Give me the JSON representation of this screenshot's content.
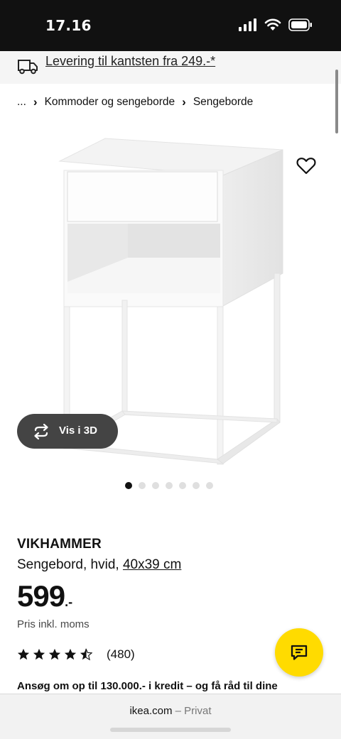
{
  "status_bar": {
    "time": "17.16"
  },
  "promo": {
    "text": "Levering til kantsten fra 249.-*"
  },
  "breadcrumb": {
    "ellipsis": "...",
    "items": [
      "Kommoder og sengeborde",
      "Sengeborde"
    ]
  },
  "gallery": {
    "view_3d_label": "Vis i 3D",
    "dots_total": 7,
    "active_dot": 1
  },
  "product": {
    "name": "VIKHAMMER",
    "description": "Sengebord, hvid,",
    "size": "40x39 cm",
    "price": "599",
    "price_suffix": ".-",
    "price_note": "Pris inkl. moms",
    "rating_stars": 4.5,
    "rating_count": "(480)",
    "credit_text": "Ansøg om op til 130.000.- i kredit – og få råd til dine"
  },
  "browser": {
    "domain": "ikea.com",
    "mode": "– Privat"
  },
  "colors": {
    "accent_yellow": "#ffdb00",
    "status_bar": "#111111",
    "promo_bg": "#f5f5f5",
    "view3d_bg": "#444444"
  },
  "icons": [
    "truck-icon",
    "heart-icon",
    "rotate-3d-icon",
    "chat-icon",
    "star-icon",
    "signal-icon",
    "wifi-icon",
    "battery-icon"
  ]
}
